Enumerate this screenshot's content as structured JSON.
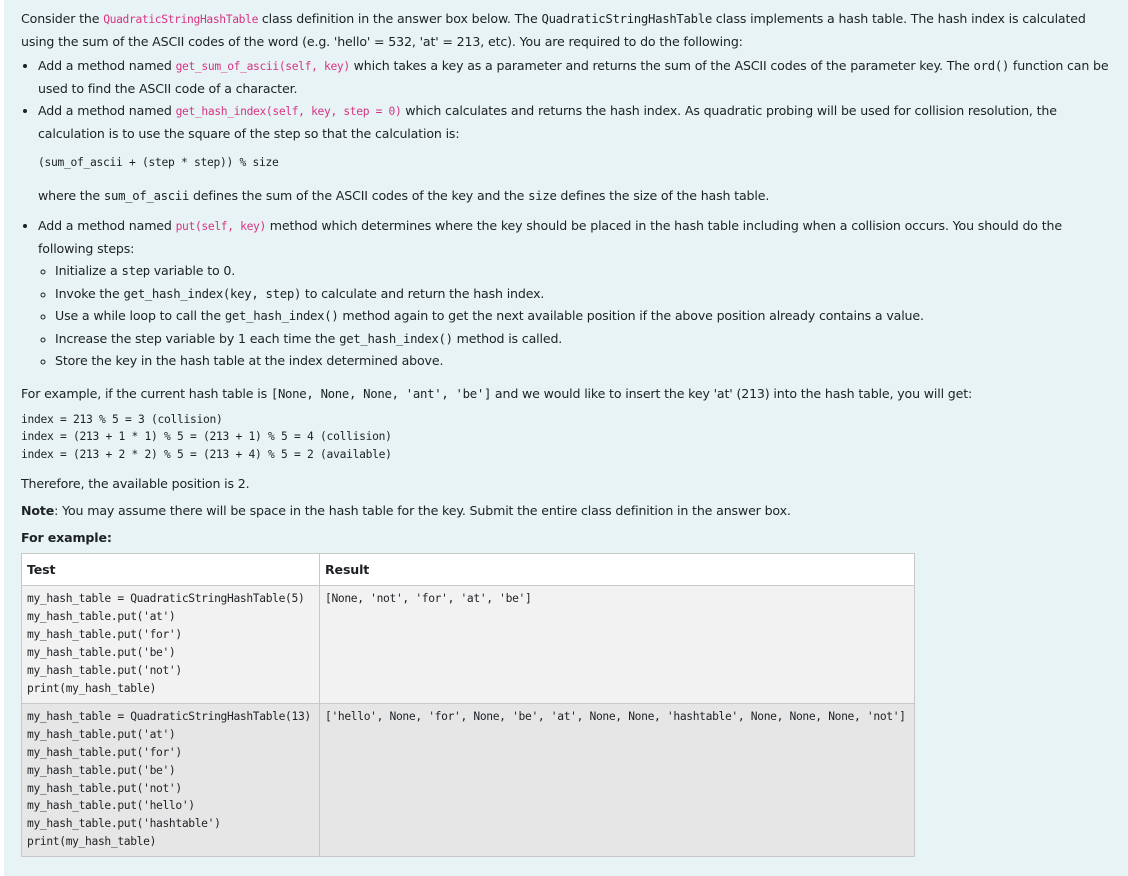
{
  "intro": {
    "t1": "Consider the ",
    "c1": "QuadraticStringHashTable",
    "t2": " class definition in the answer box below. The ",
    "m1": "QuadraticStringHashTable",
    "t3": " class implements a hash table. The hash index is calculated using the sum of the ASCII codes of the word (e.g. 'hello' = 532, 'at' = 213, etc). You are required to do the following:"
  },
  "bullet1": {
    "t1": "Add a method named ",
    "c1": "get_sum_of_ascii(self, key)",
    "t2": " which takes a key as a parameter and returns the sum of the ASCII codes of the parameter key. The ",
    "m1": "ord()",
    "t3": " function can be used to find the ASCII code of a character."
  },
  "bullet2": {
    "t1": "Add a method named ",
    "c1": "get_hash_index(self, key, step = 0)",
    "t2": " which calculates and returns the hash index. As quadratic probing will be used for collision resolution, the calculation is to use the square of the step so that the calculation is:",
    "formula": "(sum_of_ascii + (step * step)) % size",
    "t3": "where the ",
    "m1": "sum_of_ascii",
    "t4": " defines the sum of the ASCII codes of the key and the ",
    "m2": "size",
    "t5": " defines the size of the hash table."
  },
  "bullet3": {
    "t1": "Add a method named ",
    "c1": "put(self, key)",
    "t2": " method which determines where the key should be placed in the hash table including when a collision occurs. You should do the following steps:",
    "steps": {
      "s1a": "Initialize a ",
      "s1m": "step",
      "s1b": " variable to 0.",
      "s2a": "Invoke the ",
      "s2m": "get_hash_index(key, step)",
      "s2b": " to calculate and return the hash index.",
      "s3a": "Use a while loop to call the ",
      "s3m": "get_hash_index()",
      "s3b": " method again to get the next available position if the above position already contains a value.",
      "s4a": "Increase the step variable by 1 each time the ",
      "s4m": "get_hash_index()",
      "s4b": " method is called.",
      "s5": "Store the key in the hash table at the index determined above."
    }
  },
  "example_intro": {
    "t1": "For example, if the current hash table is ",
    "m1": "[None, None, None, 'ant', 'be']",
    "t2": " and we would like to insert the key 'at' (213) into the hash table, you will get:"
  },
  "calc": "index = 213 % 5 = 3 (collision)\nindex = (213 + 1 * 1) % 5 = (213 + 1) % 5 = 4 (collision)\nindex = (213 + 2 * 2) % 5 = (213 + 4) % 5 = 2 (available)",
  "conclusion": "Therefore, the available position is 2.",
  "note": {
    "label": "Note",
    "text": ": You may assume there will be space in the hash table for the key. Submit the entire class definition in the answer box."
  },
  "for_example": "For example:",
  "table": {
    "headers": [
      "Test",
      "Result"
    ],
    "rows": [
      {
        "test": "my_hash_table = QuadraticStringHashTable(5)\nmy_hash_table.put('at')\nmy_hash_table.put('for')\nmy_hash_table.put('be')\nmy_hash_table.put('not')\nprint(my_hash_table)",
        "result": "[None, 'not', 'for', 'at', 'be']"
      },
      {
        "test": "my_hash_table = QuadraticStringHashTable(13)\nmy_hash_table.put('at')\nmy_hash_table.put('for')\nmy_hash_table.put('be')\nmy_hash_table.put('not')\nmy_hash_table.put('hello')\nmy_hash_table.put('hashtable')\nprint(my_hash_table)",
        "result": "['hello', None, 'for', None, 'be', 'at', None, None, 'hashtable', None, None, None, 'not']"
      }
    ]
  },
  "colors": {
    "panel_bg": "#e7f3f5",
    "code_pink": "#d63384",
    "row1_bg": "#f2f2f2",
    "row2_bg": "#e6e6e6"
  }
}
